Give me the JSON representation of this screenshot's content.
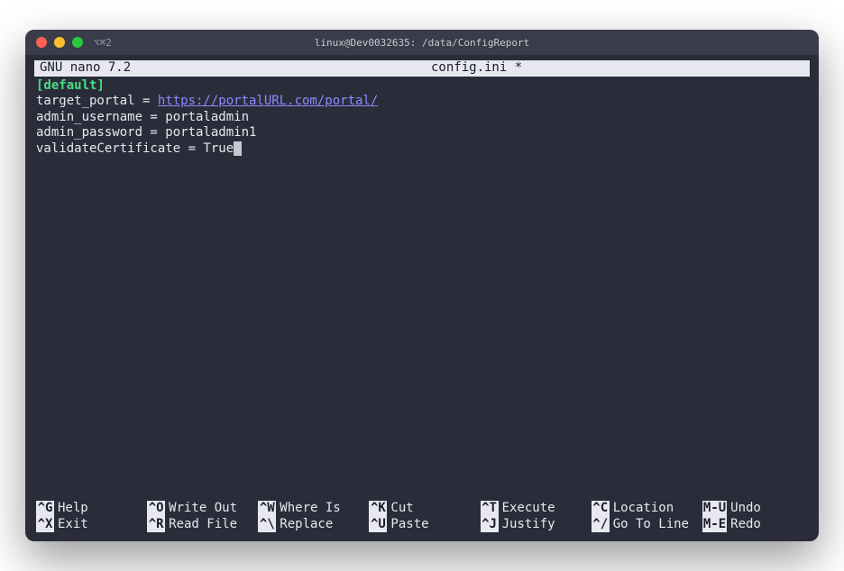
{
  "titlebar": {
    "tab_label": "⌥⌘2",
    "title": "linux@Dev0032635: /data/ConfigReport"
  },
  "nano": {
    "app_label": "GNU nano 7.2",
    "file_label": "config.ini *"
  },
  "file": {
    "section": "[default]",
    "lines": {
      "target_key": "target_portal = ",
      "target_url": "https://portalURL.com/portal/",
      "admin_user": "admin_username = portaladmin",
      "admin_pass": "admin_password = portaladmin1",
      "validate": "validateCertificate = True"
    }
  },
  "shortcuts": {
    "r0c0": {
      "key": "^G",
      "label": "Help"
    },
    "r0c1": {
      "key": "^O",
      "label": "Write Out"
    },
    "r0c2": {
      "key": "^W",
      "label": "Where Is"
    },
    "r0c3": {
      "key": "^K",
      "label": "Cut"
    },
    "r0c4": {
      "key": "^T",
      "label": "Execute"
    },
    "r0c5": {
      "key": "^C",
      "label": "Location"
    },
    "r0c6": {
      "key": "M-U",
      "label": "Undo"
    },
    "r1c0": {
      "key": "^X",
      "label": "Exit"
    },
    "r1c1": {
      "key": "^R",
      "label": "Read File"
    },
    "r1c2": {
      "key": "^\\",
      "label": "Replace"
    },
    "r1c3": {
      "key": "^U",
      "label": "Paste"
    },
    "r1c4": {
      "key": "^J",
      "label": "Justify"
    },
    "r1c5": {
      "key": "^/",
      "label": "Go To Line"
    },
    "r1c6": {
      "key": "M-E",
      "label": "Redo"
    }
  }
}
